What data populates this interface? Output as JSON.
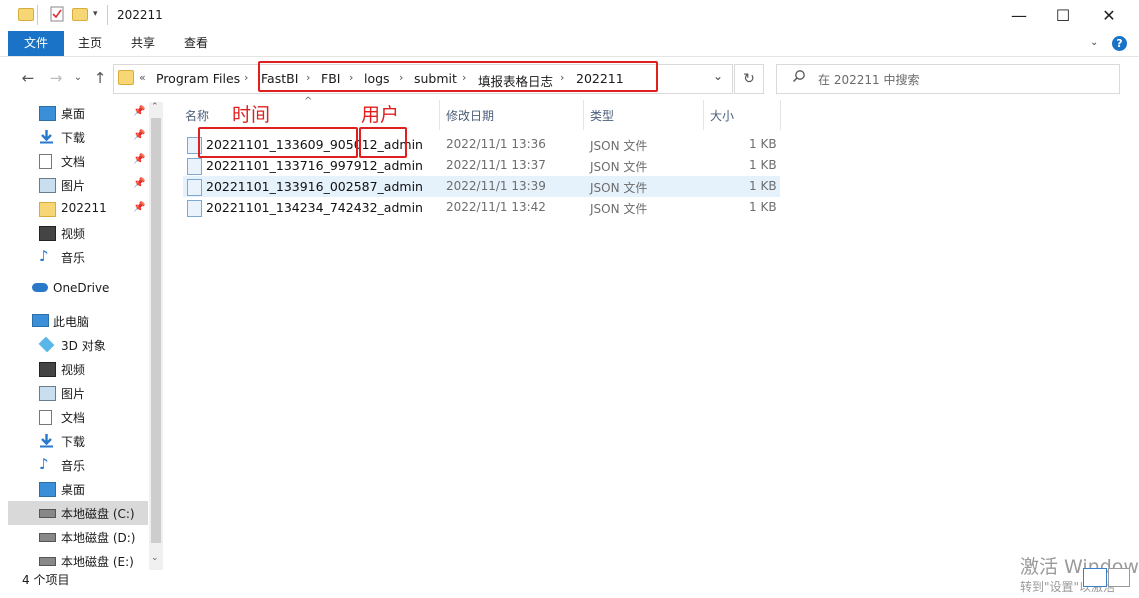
{
  "window": {
    "title": "202211"
  },
  "ribbon_tabs": [
    "文件",
    "主页",
    "共享",
    "查看"
  ],
  "address": {
    "overflow": "«",
    "crumbs": [
      "Program Files",
      "FastBI",
      "FBI",
      "logs",
      "submit",
      "填报表格日志",
      "202211"
    ]
  },
  "search": {
    "placeholder": "在 202211 中搜索"
  },
  "sidebar": {
    "quick_access": [
      "桌面",
      "下载",
      "文档",
      "图片",
      "202211",
      "视频",
      "音乐"
    ],
    "onedrive": "OneDrive",
    "this_pc": "此电脑",
    "pc_items": [
      "3D 对象",
      "视频",
      "图片",
      "文档",
      "下载",
      "音乐",
      "桌面",
      "本地磁盘 (C:)",
      "本地磁盘 (D:)",
      "本地磁盘 (E:)"
    ]
  },
  "columns": {
    "name": "名称",
    "modified": "修改日期",
    "type": "类型",
    "size": "大小"
  },
  "files": [
    {
      "name": "20221101_133609_905012_admin",
      "modified": "2022/11/1 13:36",
      "type": "JSON 文件",
      "size": "1 KB"
    },
    {
      "name": "20221101_133716_997912_admin",
      "modified": "2022/11/1 13:37",
      "type": "JSON 文件",
      "size": "1 KB"
    },
    {
      "name": "20221101_133916_002587_admin",
      "modified": "2022/11/1 13:39",
      "type": "JSON 文件",
      "size": "1 KB"
    },
    {
      "name": "20221101_134234_742432_admin",
      "modified": "2022/11/1 13:42",
      "type": "JSON 文件",
      "size": "1 KB"
    }
  ],
  "annotations": {
    "time_label": "时间",
    "user_label": "用户"
  },
  "status": {
    "item_count": "4 个项目"
  },
  "watermark": {
    "line1": "激活 Window",
    "line2": "转到\"设置\"以激活"
  }
}
